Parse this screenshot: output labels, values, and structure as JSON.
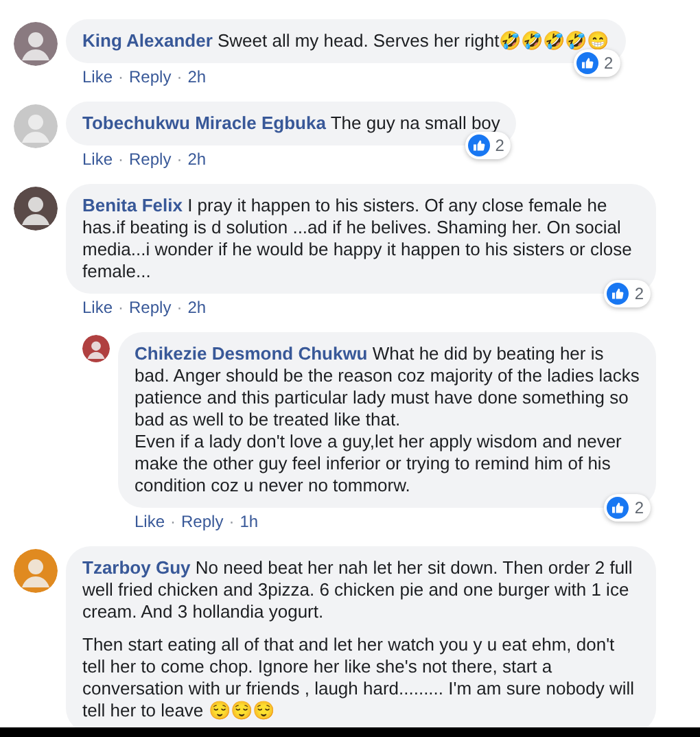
{
  "comments": [
    {
      "author": "King Alexander",
      "text": "Sweet all my head. Serves her right🤣🤣🤣🤣😁",
      "actions": [
        "Like",
        "·",
        "Reply",
        "·",
        "2h"
      ],
      "reactions": "2"
    },
    {
      "author": "Tobechukwu Miracle Egbuka",
      "text": "The guy na small boy",
      "actions": [
        "Like",
        "·",
        "Reply",
        "·",
        "2h"
      ],
      "reactions": "2"
    },
    {
      "author": "Benita Felix",
      "text": "I pray it happen to his sisters. Of any close female he has.if beating is d solution ...ad if he belives. Shaming her. On social media...i wonder if he would be happy it happen to his sisters or close female...",
      "actions": [
        "Like",
        "·",
        "Reply",
        "·",
        "2h"
      ],
      "reactions": "2",
      "replies": [
        {
          "author": "Chikezie Desmond Chukwu",
          "text": "What he did by beating her is bad. Anger should be the reason coz majority of the ladies lacks patience and this particular lady must have done something so bad as well to be treated like that.\nEven if a lady don't love a guy,let her apply wisdom and never make the other guy feel inferior or trying to remind him of his condition coz u never no tommorw.",
          "actions": [
            "Like",
            "·",
            "Reply",
            "·",
            "1h"
          ],
          "reactions": "2"
        }
      ]
    },
    {
      "author": "Tzarboy Guy",
      "text": "No need beat her nah let her sit down. Then order 2 full well fried chicken and 3pizza. 6 chicken pie and one burger with 1 ice cream. And 3 hollandia yogurt.\n\nThen start eating all of that and let her watch you y u eat ehm, don't tell her to come chop. Ignore her like she's not there, start a conversation with ur friends , laugh hard......... I'm am sure nobody will tell her to leave 😌😌😌"
    }
  ]
}
